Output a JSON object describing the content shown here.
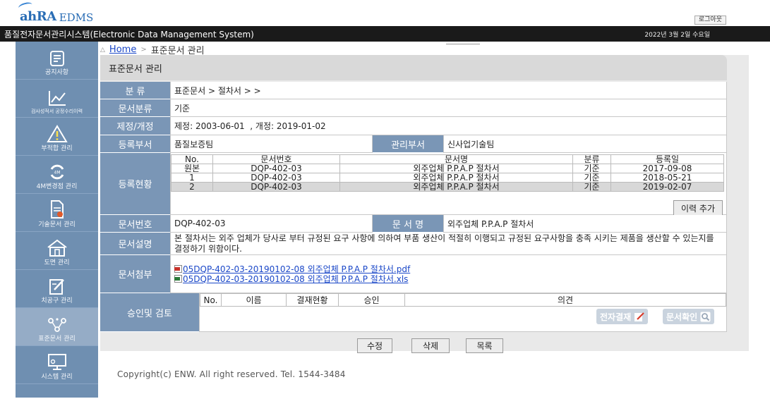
{
  "brand": {
    "logo_text": "ahRA",
    "product": "EDMS"
  },
  "header": {
    "logout_label": "로그아웃",
    "system_title": "품질전자문서관리시스템(Electronic Data Management System)",
    "date": "2022년 3월 2일 수요일"
  },
  "sidebar": {
    "items": [
      {
        "label": "공지사항",
        "icon": "notice-icon"
      },
      {
        "label": "검사성적서 공정수리이력",
        "icon": "chart-icon"
      },
      {
        "label": "부적합 관리",
        "icon": "warning-icon"
      },
      {
        "label": "4M변경점 관리",
        "icon": "4m-icon"
      },
      {
        "label": "기술문서 관리",
        "icon": "document-icon"
      },
      {
        "label": "도면 관리",
        "icon": "drawing-icon"
      },
      {
        "label": "치공구 관리",
        "icon": "tool-icon"
      },
      {
        "label": "표준문서 관리",
        "icon": "share-icon"
      },
      {
        "label": "시스템 관리",
        "icon": "monitor-icon"
      }
    ]
  },
  "breadcrumb": {
    "home": "Home",
    "current": "표준문서 관리"
  },
  "panel": {
    "title": "표준문서 관리",
    "category_label": "분 류",
    "category_value": "표준문서 > 절차서 > >",
    "doctype_label": "문서분류",
    "doctype_value": "기준",
    "revision_label": "제정/개정",
    "revision_value": "제정: 2003-06-01  , 개정: 2019-01-02",
    "reg_dept_label": "등록부서",
    "reg_dept_value": "품질보증팀",
    "mgmt_dept_label": "관리부서",
    "mgmt_dept_value": "신사업기술팀",
    "status_label": "등록현황",
    "status_table": {
      "headers": [
        "No.",
        "문서번호",
        "문서명",
        "분류",
        "등록일"
      ],
      "rows": [
        {
          "no": "원본",
          "docno": "DQP-402-03",
          "name": "외주업체 P.P.A.P 절차서",
          "type": "기준",
          "date": "2017-09-08"
        },
        {
          "no": "1",
          "docno": "DQP-402-03",
          "name": "외주업체 P.P.A.P 절차서",
          "type": "기준",
          "date": "2018-05-21"
        },
        {
          "no": "2",
          "docno": "DQP-402-03",
          "name": "외주업체 P.P.A.P 절차서",
          "type": "기준",
          "date": "2019-02-07"
        }
      ]
    },
    "history_button": "이력 추가",
    "docno_label": "문서번호",
    "docno_value": "DQP-402-03",
    "docname_label": "문 서 명",
    "docname_value": "외주업체 P.P.A.P 절차서",
    "desc_label": "문서설명",
    "desc_value": "본 절차서는 외주 업체가 당사로 부터 규정된 요구 사항에 의하여 부품 생산이 적절히 이행되고 규정된 요구사항을 충족 시키는 제품을 생산할 수 있는지를 결정하기 위함이다.",
    "attach_label": "문서첨부",
    "attachments": [
      "05DQP-402-03-20190102-08 외주업체 P.P.A.P 절차서.pdf",
      "05DQP-402-03-20190102-08 외주업체 P.P.A.P 절차서.xls"
    ],
    "approval_label": "승인및 검토",
    "approval_headers": [
      "No.",
      "이름",
      "결재현황",
      "승인",
      "의견"
    ],
    "esign_button": "전자결재",
    "doccheck_button": "문서확인"
  },
  "actions": {
    "edit": "수정",
    "delete": "삭제",
    "list": "목록"
  },
  "footer": {
    "copyright": "Copyright(c) ENW. All right reserved. Tel. 1544-3484"
  }
}
